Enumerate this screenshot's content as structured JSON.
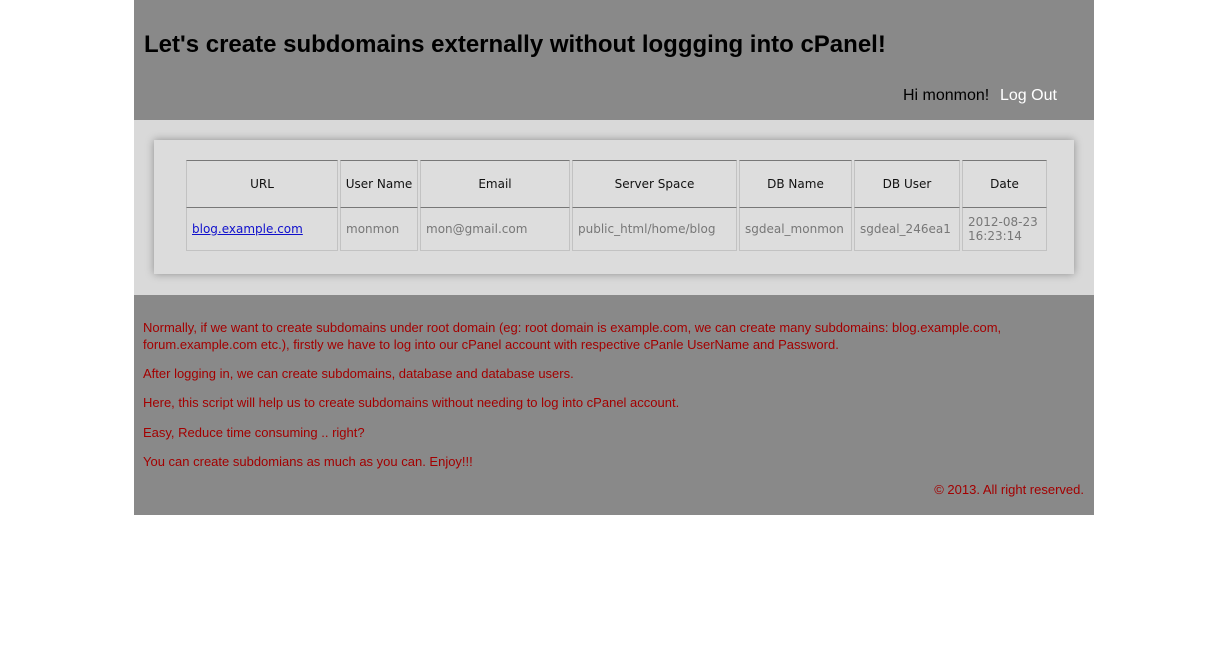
{
  "header": {
    "title": "Let's create subdomains externally without loggging into cPanel!",
    "greeting": "Hi monmon!",
    "logout_label": "Log Out"
  },
  "table": {
    "columns": [
      "URL",
      "User Name",
      "Email",
      "Server Space",
      "DB Name",
      "DB User",
      "Date"
    ],
    "rows": [
      {
        "url": "blog.example.com",
        "user_name": "monmon",
        "email": "mon@gmail.com",
        "server_space": "public_html/home/blog",
        "db_name": "sgdeal_monmon",
        "db_user": "sgdeal_246ea1",
        "date": "2012-08-23 16:23:14"
      }
    ]
  },
  "footer": {
    "paragraphs": [
      "Normally, if we want to create subdomains under root domain (eg: root domain is example.com, we can create many subdomains: blog.example.com, forum.example.com etc.), firstly we have to log into our cPanel account with respective cPanle UserName and Password.",
      "After logging in, we can create subdomains, database and database users.",
      "Here, this script will help us to create subdomains without needing to log into cPanel account.",
      "Easy, Reduce time consuming .. right?",
      "You can create subdomians as much as you can. Enjoy!!!"
    ],
    "copyright": "© 2013. All right reserved."
  }
}
